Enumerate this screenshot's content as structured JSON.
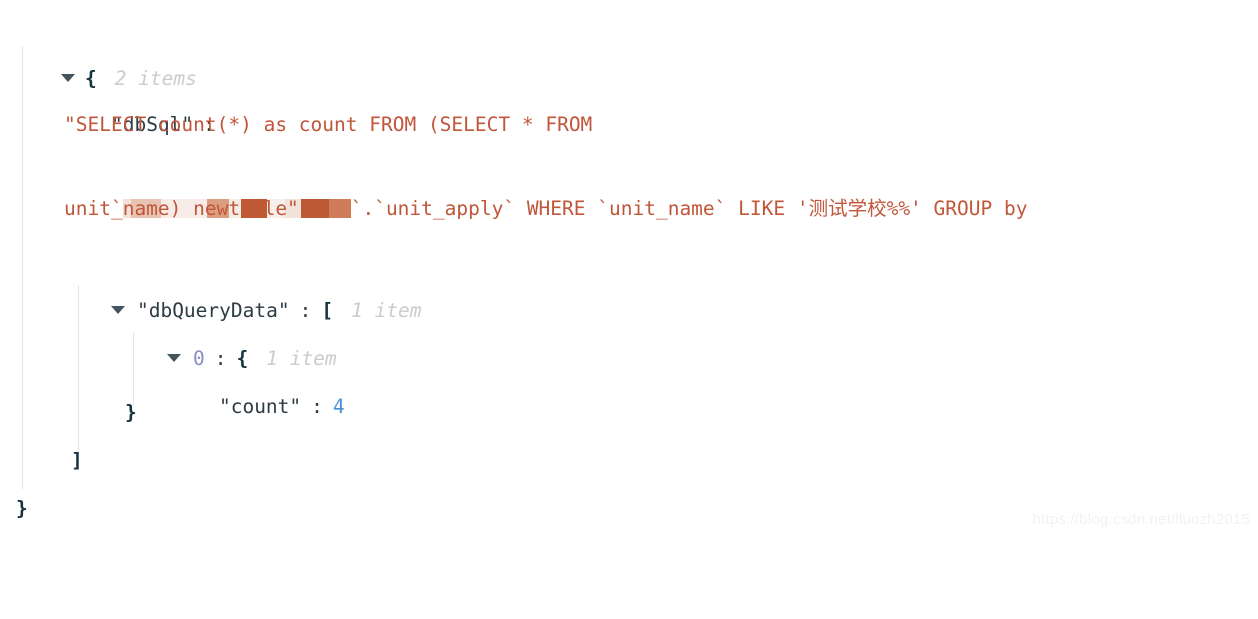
{
  "viewer": {
    "type": "json-tree-viewer",
    "background": "#ffffff",
    "colors": {
      "key": "#2b3c45",
      "string": "#c0563a",
      "number": "#4a90d9",
      "index": "#8b8bc8",
      "brace": "#17333f",
      "meta": "#cccccc",
      "guide": "#e2e2e2",
      "triangle": "#44545c",
      "redaction": "#c0563a"
    }
  },
  "root": {
    "open_brace": "{",
    "item_count_label": "2 items",
    "close_brace": "}"
  },
  "db_sql": {
    "key": "\"dbSql\"",
    "colon": ":",
    "line1": "\"SELECT count(*) as count FROM (SELECT * FROM",
    "line2_prefix": "`",
    "redacted_label": "redacted-database-name",
    "line2_suffix": "`.`unit_apply` WHERE `unit_name` LIKE '测试学校%%' GROUP by",
    "line3": "unit_name) newtable\"",
    "full_value": "SELECT count(*) as count FROM (SELECT * FROM `████████`.`unit_apply` WHERE `unit_name` LIKE '测试学校%%' GROUP by unit_name) newtable"
  },
  "db_query_data": {
    "key": "\"dbQueryData\"",
    "colon": ":",
    "open_bracket": "[",
    "item_count_label": "1 item",
    "close_bracket": "]",
    "element": {
      "index": "0",
      "colon": ":",
      "open_brace": "{",
      "item_count_label": "1 item",
      "close_brace": "}",
      "fields": [
        {
          "key": "\"count\"",
          "colon": ":",
          "value": "4"
        }
      ]
    }
  },
  "watermark": {
    "text": "https://blog.csdn.net/lluozh2015"
  }
}
